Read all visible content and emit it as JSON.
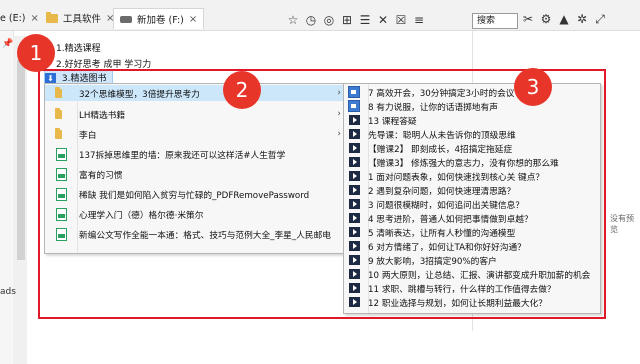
{
  "tabs": [
    {
      "label": "e (E:)",
      "close": "×"
    },
    {
      "label": "工具软件",
      "close": "×"
    },
    {
      "label": "新加卷 (F:)",
      "close": "×"
    }
  ],
  "search": {
    "placeholder": "搜索"
  },
  "main_items": [
    "1.精选课程",
    "2.好好思考 成甲 学习力",
    "3.精选图书"
  ],
  "menu1": [
    {
      "label": "32个思维模型，3倍提升思考力",
      "icon": "folder-icon",
      "sub": "›"
    },
    {
      "label": "LH精选书籍",
      "icon": "folder-icon",
      "sub": "›"
    },
    {
      "label": "李白",
      "icon": "folder-icon",
      "sub": "›"
    },
    {
      "label": "137拆掉思维里的墙：原来我还可以这样活#人生哲学",
      "icon": "pdf-icon"
    },
    {
      "label": "富有的习惯",
      "icon": "pdf-icon"
    },
    {
      "label": "稀缺 我们是如何陷入贫穷与忙碌的_PDFRemovePassword",
      "icon": "pdf-icon"
    },
    {
      "label": "心理学入门（德）格尔德·米策尔",
      "icon": "pdf-icon"
    },
    {
      "label": "新编公文写作全能一本通：格式、技巧与范例大全_李星_人民邮电",
      "icon": "pdf-icon"
    }
  ],
  "menu2": [
    {
      "label": "7 高效开会，30分钟搞定3小时的会议",
      "icon": "image-icon"
    },
    {
      "label": "8 有力说服，让你的话语掷地有声",
      "icon": "image-icon"
    },
    {
      "label": "13 课程答疑",
      "icon": "video-icon"
    },
    {
      "label": "先导课：聪明人从未告诉你的顶级思维",
      "icon": "video-icon"
    },
    {
      "label": "【赠课2】 即刻成长，4招搞定拖延症",
      "icon": "video-icon"
    },
    {
      "label": "【赠课3】 修炼强大的意志力，没有你想的那么难",
      "icon": "video-icon"
    },
    {
      "label": "1 面对问题表象，如何快速找到核心关 键点？",
      "icon": "video-icon"
    },
    {
      "label": "2 遇到复杂问题，如何快速理清思路？",
      "icon": "video-icon"
    },
    {
      "label": "3 问题很模糊时，如何追问出关键信息？",
      "icon": "video-icon"
    },
    {
      "label": "4 思考进阶，普通人如何把事情做到卓越？",
      "icon": "video-icon"
    },
    {
      "label": "5 清晰表达，让所有人秒懂的沟通模型",
      "icon": "video-icon"
    },
    {
      "label": "6 对方情绪了，如何让TA和你好好沟通？",
      "icon": "video-icon"
    },
    {
      "label": "9 放大影响，3招搞定90%的客户",
      "icon": "video-icon"
    },
    {
      "label": "10 两大原则，让总结、汇报、演讲都变成升职加薪的机会",
      "icon": "video-icon"
    },
    {
      "label": "11 求职、跳槽与转行，什么样的工作值得去做？",
      "icon": "video-icon"
    },
    {
      "label": "12 职业选择与规划，如何让长期利益最大化？",
      "icon": "video-icon"
    }
  ],
  "badges": [
    "1",
    "2",
    "3"
  ],
  "side_texts": {
    "left": "ads",
    "preview": "没有预览"
  },
  "colors": {
    "annotation_red": "#e0192a",
    "badge_red": "#e8352a",
    "highlight": "#cce6fa"
  }
}
